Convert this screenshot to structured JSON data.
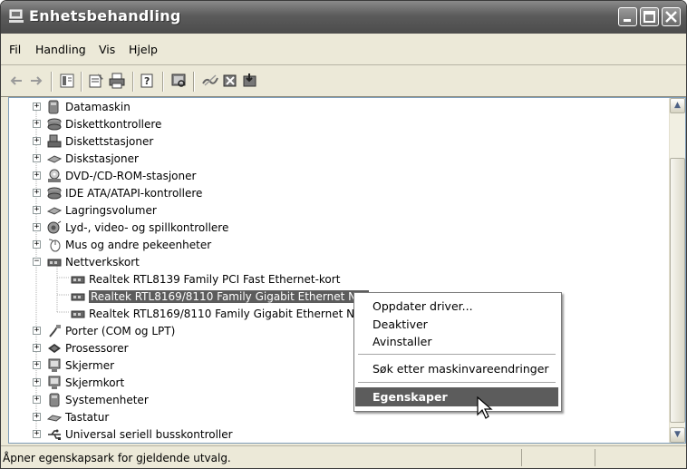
{
  "window": {
    "title": "Enhetsbehandling",
    "icon": "computer-manager-icon"
  },
  "menubar": {
    "items": [
      "Fil",
      "Handling",
      "Vis",
      "Hjelp"
    ]
  },
  "toolbar": {
    "icons": [
      "back-arrow-icon",
      "forward-arrow-icon",
      "tree-view-icon",
      "properties-icon",
      "print-icon",
      "help-icon",
      "scan-hardware-icon",
      "disable-device-icon",
      "uninstall-icon",
      "update-driver-icon"
    ]
  },
  "tree": {
    "items": [
      {
        "label": "Datamaskin",
        "expander": "+"
      },
      {
        "label": "Diskettkontrollere",
        "expander": "+"
      },
      {
        "label": "Diskettstasjoner",
        "expander": "+"
      },
      {
        "label": "Diskstasjoner",
        "expander": "+"
      },
      {
        "label": "DVD-/CD-ROM-stasjoner",
        "expander": "+"
      },
      {
        "label": "IDE ATA/ATAPI-kontrollere",
        "expander": "+"
      },
      {
        "label": "Lagringsvolumer",
        "expander": "+"
      },
      {
        "label": "Lyd-, video- og spillkontrollere",
        "expander": "+"
      },
      {
        "label": "Mus og andre pekeenheter",
        "expander": "+"
      },
      {
        "label": "Nettverkskort",
        "expander": "−"
      },
      {
        "label": "Realtek RTL8139 Family PCI Fast Ethernet-kort",
        "expander": ""
      },
      {
        "label": "Realtek RTL8169/8110 Family Gigabit Ethernet NIC",
        "expander": ""
      },
      {
        "label": "Realtek RTL8169/8110 Family Gigabit Ethernet NIC",
        "expander": ""
      },
      {
        "label": "Porter (COM og LPT)",
        "expander": "+"
      },
      {
        "label": "Prosessorer",
        "expander": "+"
      },
      {
        "label": "Skjermer",
        "expander": "+"
      },
      {
        "label": "Skjermkort",
        "expander": "+"
      },
      {
        "label": "Systemenheter",
        "expander": "+"
      },
      {
        "label": "Tastatur",
        "expander": "+"
      },
      {
        "label": "Universal seriell busskontroller",
        "expander": "+"
      }
    ]
  },
  "context_menu": {
    "items": [
      "Oppdater driver...",
      "Deaktiver",
      "Avinstaller",
      "Søk etter maskinvareendringer",
      "Egenskaper"
    ],
    "highlighted": "Egenskaper"
  },
  "statusbar": {
    "text": "Åpner egenskapsark for gjeldende utvalg."
  },
  "colors": {
    "selection": "#5c5c5c",
    "title_bar": "#5b5b5b"
  }
}
